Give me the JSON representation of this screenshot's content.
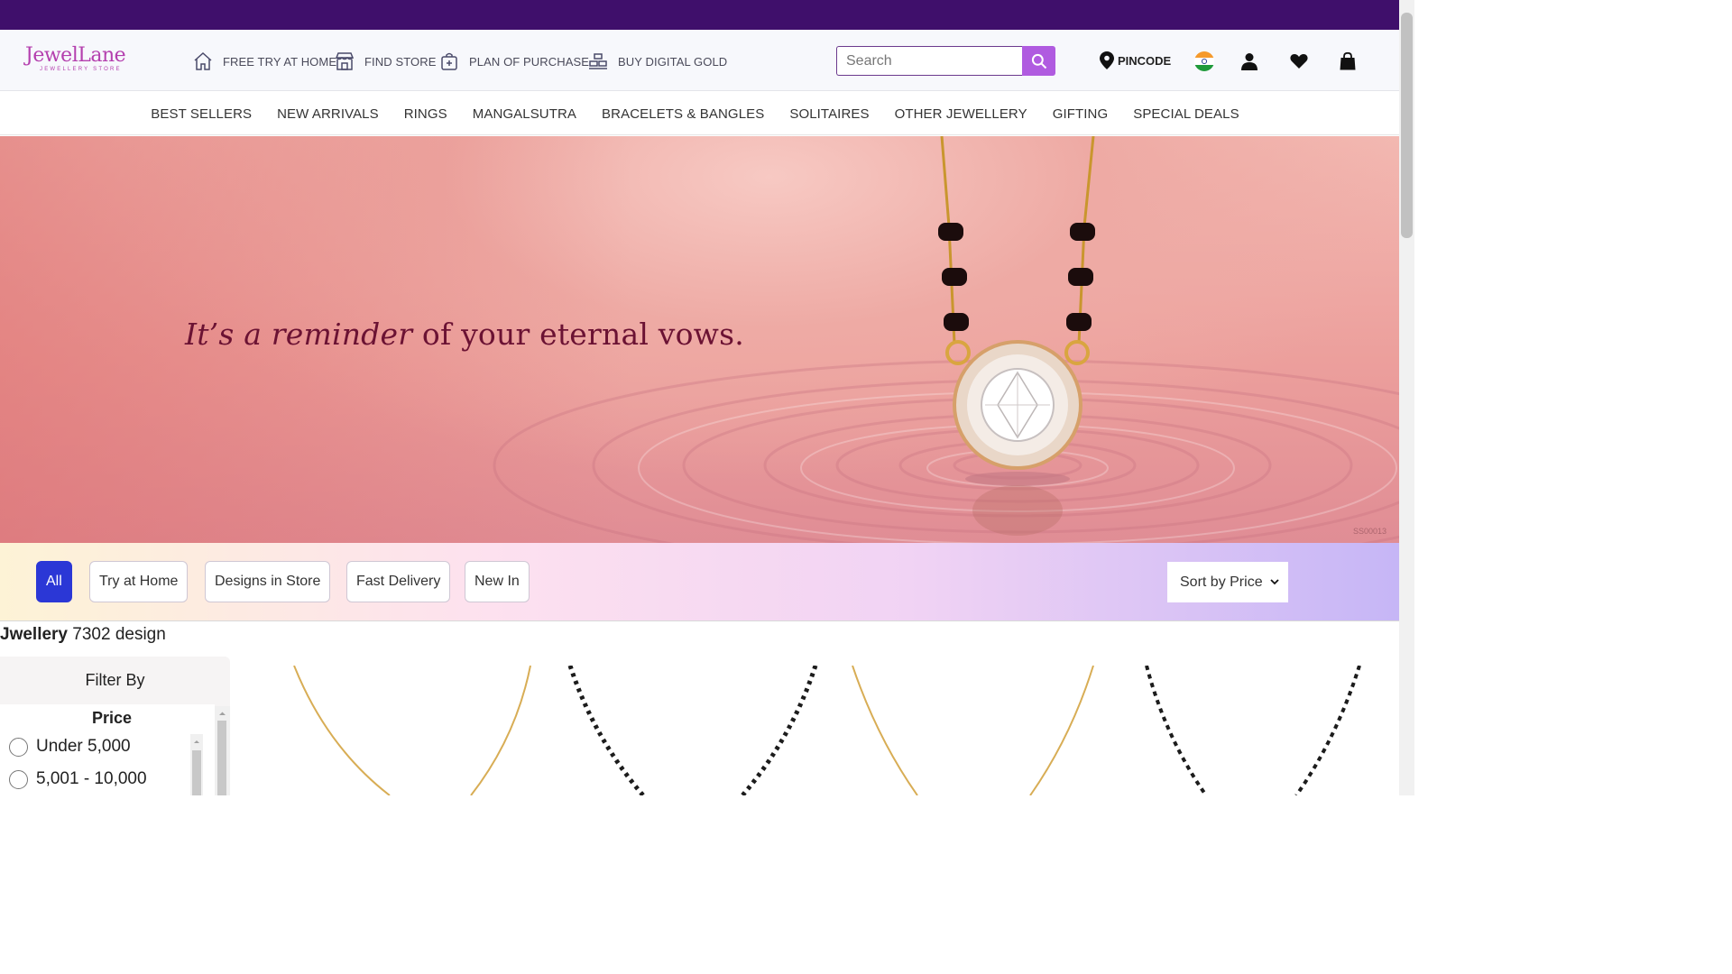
{
  "brand": {
    "name": "JewelLane",
    "tagline": "JEWELLERY STORE",
    "accent": "#b43fae",
    "topbar_color": "#3f0f6b"
  },
  "utility_links": [
    {
      "label": "FREE TRY AT HOME",
      "icon": "home-icon"
    },
    {
      "label": "FIND STORE",
      "icon": "store-icon"
    },
    {
      "label": "PLAN OF PURCHASE",
      "icon": "gift-bag-icon"
    },
    {
      "label": "BUY DIGITAL GOLD",
      "icon": "gold-bars-icon"
    }
  ],
  "search": {
    "placeholder": "Search",
    "value": "",
    "button_icon": "search-icon",
    "button_color": "#b05be0"
  },
  "header_actions": {
    "pincode_label": "PINCODE",
    "pincode_icon": "location-pin-icon",
    "flag_icon": "india-flag-icon",
    "account_icon": "user-icon",
    "wishlist_icon": "heart-icon",
    "cart_icon": "shopping-bag-icon"
  },
  "nav": [
    "BEST SELLERS",
    "NEW ARRIVALS",
    "RINGS",
    "MANGALSUTRA",
    "BRACELETS & BANGLES",
    "SOLITAIRES",
    "OTHER JEWELLERY",
    "GIFTING",
    "SPECIAL DEALS"
  ],
  "banner": {
    "text_italic": "It’s a reminder",
    "text_rest": " of your eternal vows.",
    "code": "SS00013"
  },
  "quick_filters": {
    "chips": [
      "All",
      "Try at Home",
      "Designs in Store",
      "Fast Delivery",
      "New In"
    ],
    "active": "All",
    "active_color": "#2b37d6"
  },
  "sort": {
    "selected": "Sort by Price"
  },
  "results": {
    "category": "Jwellery",
    "count_text": "7302 design"
  },
  "filters": {
    "title": "Filter By",
    "price_title": "Price",
    "price_options": [
      "Under 5,000",
      "5,001 - 10,000"
    ]
  }
}
